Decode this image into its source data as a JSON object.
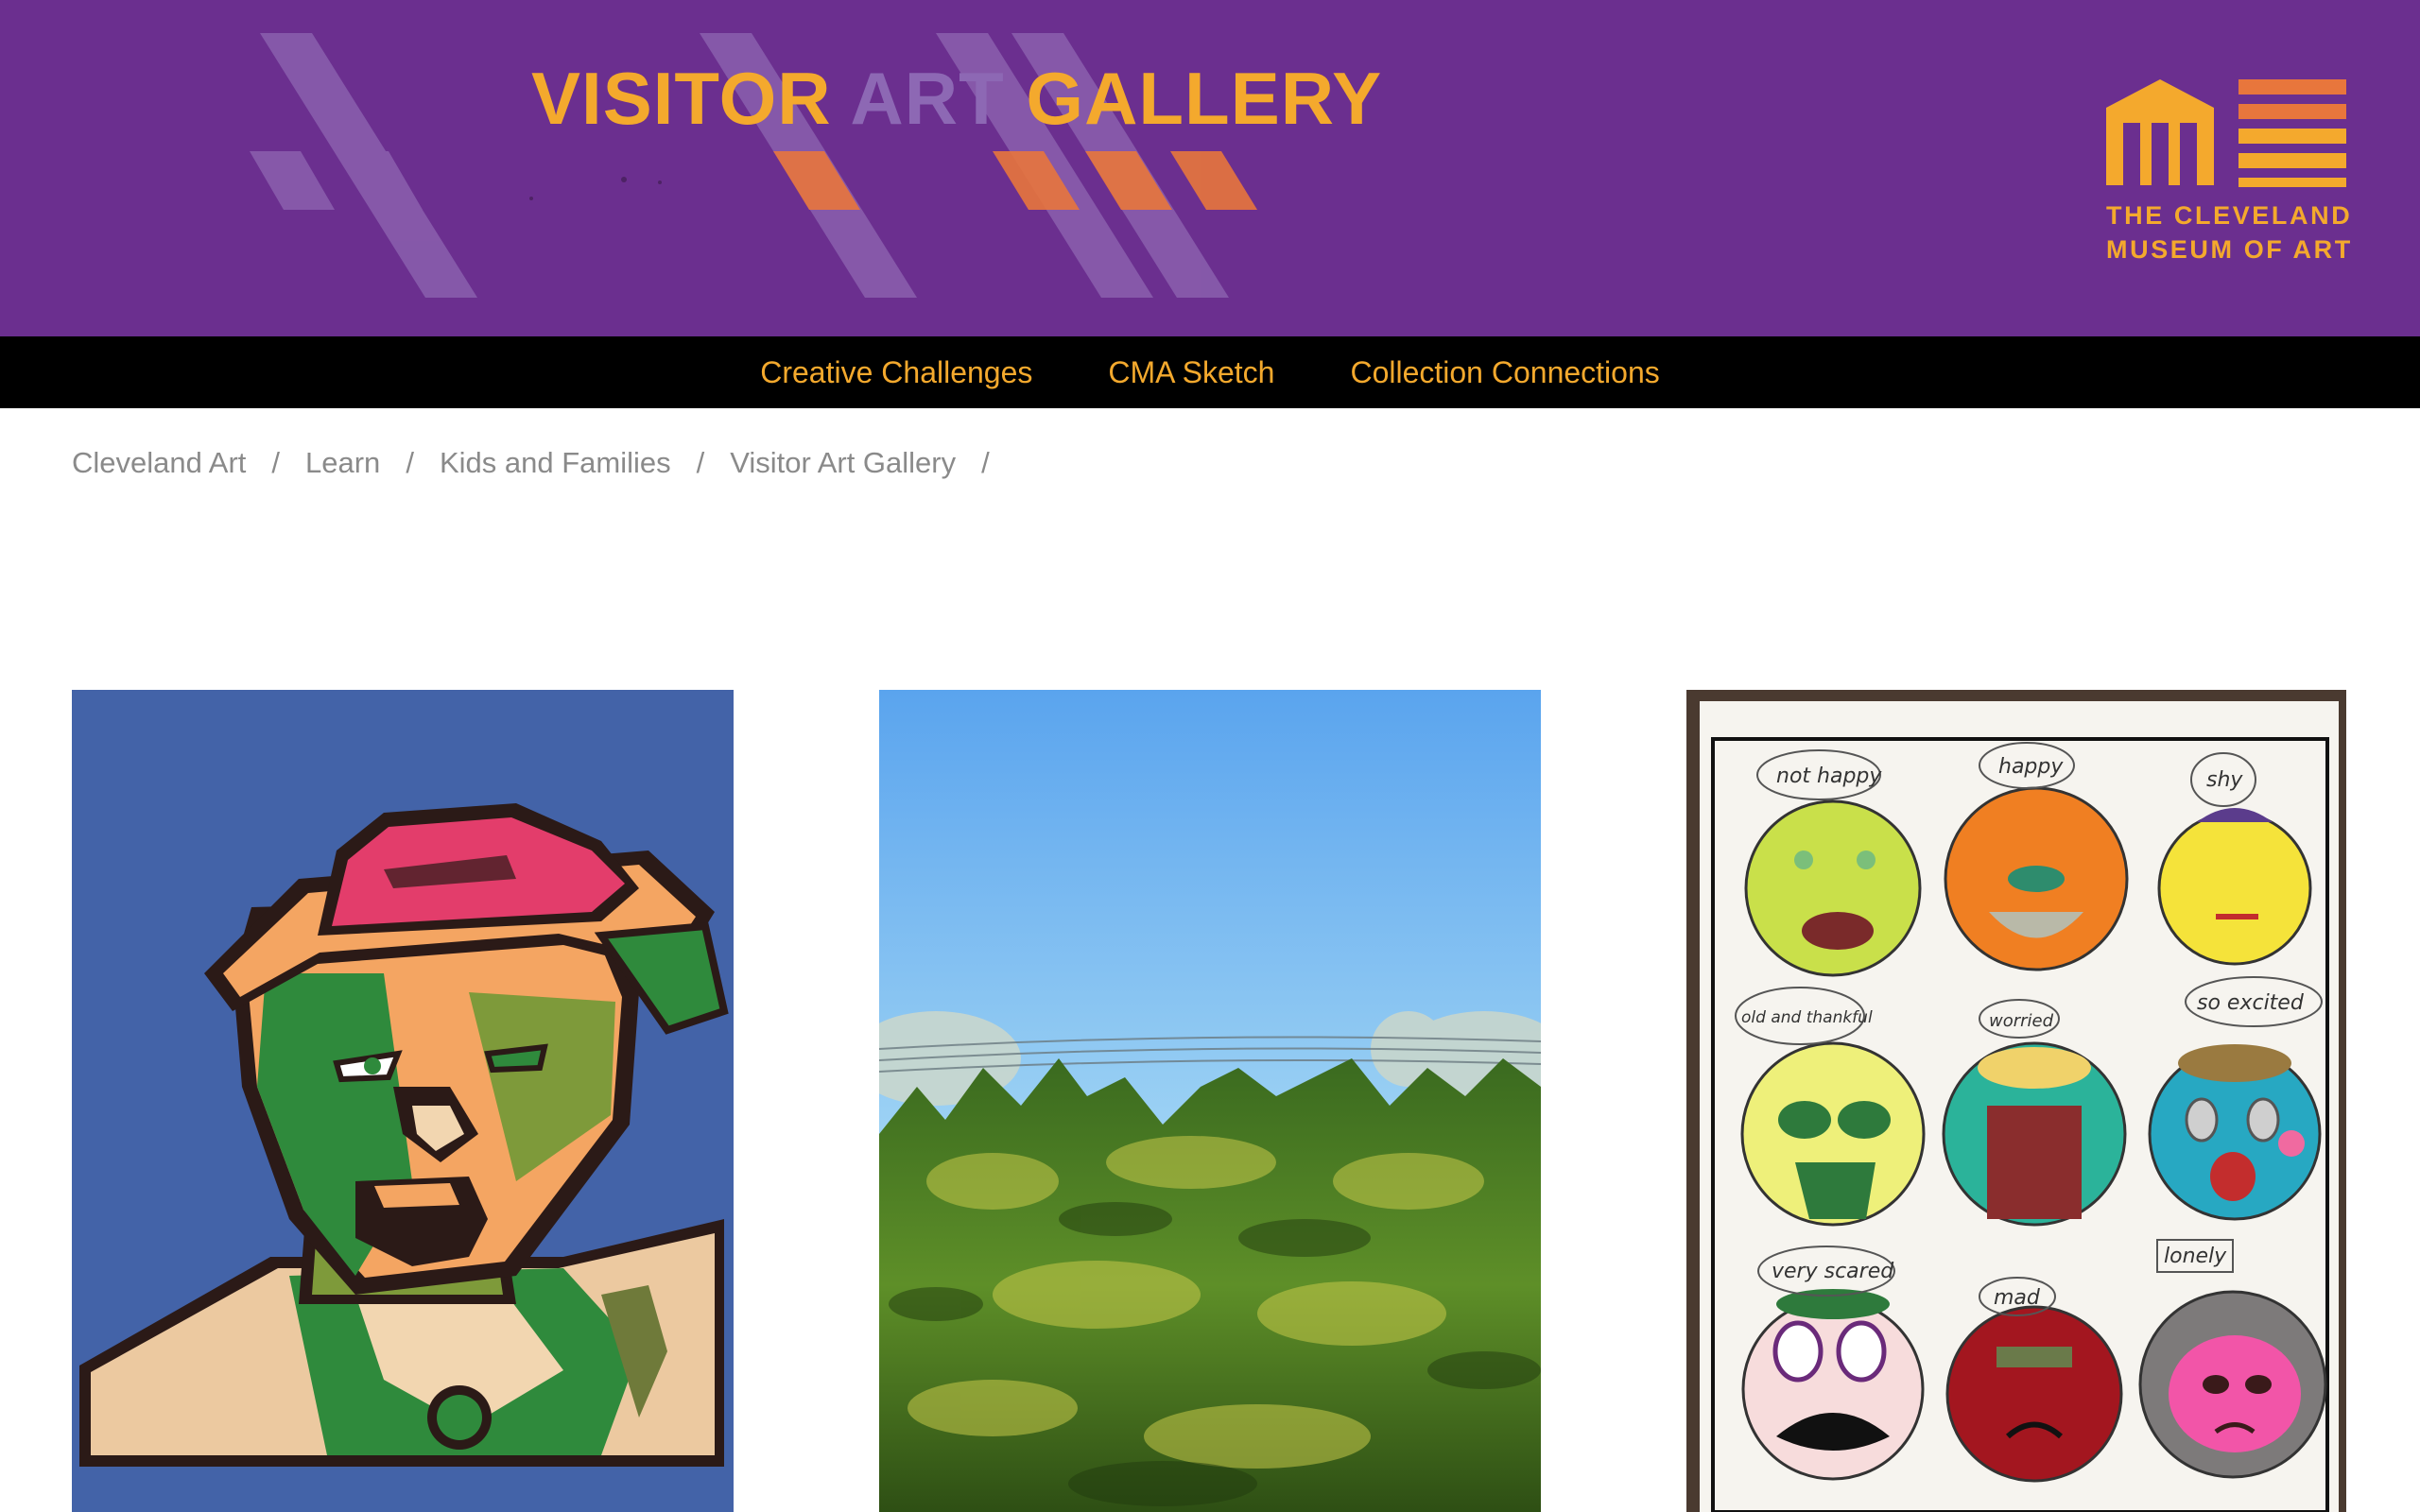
{
  "header": {
    "title_words": [
      "VISITOR",
      "ART",
      "GALLERY"
    ],
    "logo": {
      "icon": "cleveland-museum-logo-icon",
      "line1": "THE CLEVELAND",
      "line2": "MUSEUM OF ART"
    }
  },
  "colors": {
    "header_bg": "#6b2f8f",
    "accent": "#f4a92d",
    "title_muted": "#8d68b4",
    "nav_bg": "#000000",
    "breadcrumb_text": "#8a8a8a"
  },
  "nav": {
    "items": [
      {
        "label": "Creative Challenges"
      },
      {
        "label": "CMA Sketch"
      },
      {
        "label": "Collection Connections"
      }
    ]
  },
  "breadcrumb": {
    "items": [
      {
        "label": "Cleveland Art"
      },
      {
        "label": "Learn"
      },
      {
        "label": "Kids and Families"
      },
      {
        "label": "Visitor Art Gallery"
      }
    ],
    "separator": "/"
  },
  "gallery": {
    "cards": [
      {
        "image": "paper-collage-portrait-of-man-in-red-hat"
      },
      {
        "image": "photo-of-green-shrubs-under-blue-sky"
      },
      {
        "image": "drawing-of-nine-emotion-faces"
      }
    ],
    "emotion_labels": [
      "not happy",
      "happy",
      "shy",
      "old and thankful",
      "worried",
      "so excited",
      "very scared",
      "mad",
      "lonely"
    ]
  }
}
